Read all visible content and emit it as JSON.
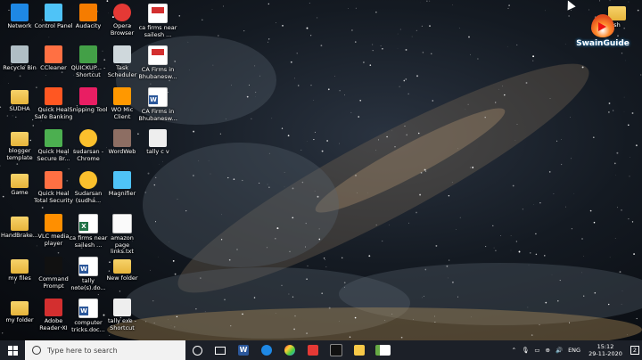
{
  "desktop": {
    "icons": [
      {
        "label": "Network",
        "type": "network",
        "col": 0,
        "row": 0
      },
      {
        "label": "Control Panel",
        "type": "control",
        "col": 1,
        "row": 0
      },
      {
        "label": "Audacity",
        "type": "audacity",
        "col": 2,
        "row": 0
      },
      {
        "label": "Opera Browser",
        "type": "opera",
        "col": 3,
        "row": 0
      },
      {
        "label": "ca firms near sailesh ...",
        "type": "pdf",
        "col": 4,
        "row": 0
      },
      {
        "label": "Recycle Bin",
        "type": "recycle",
        "col": 0,
        "row": 1
      },
      {
        "label": "CCleaner",
        "type": "ccleaner",
        "col": 1,
        "row": 1
      },
      {
        "label": "QUICKUP... - Shortcut",
        "type": "quickup",
        "col": 2,
        "row": 1
      },
      {
        "label": "Task Scheduler",
        "type": "task",
        "col": 3,
        "row": 1
      },
      {
        "label": "CA Firms in Bhubanesw...",
        "type": "pdf",
        "col": 4,
        "row": 1
      },
      {
        "label": "SUDHA",
        "type": "folder",
        "col": 0,
        "row": 2
      },
      {
        "label": "Quick Heal Safe Banking",
        "type": "qhbank",
        "col": 1,
        "row": 2
      },
      {
        "label": "Snipping Tool",
        "type": "snip",
        "col": 2,
        "row": 2
      },
      {
        "label": "WO Mic Client",
        "type": "womic",
        "col": 3,
        "row": 2
      },
      {
        "label": "CA Firms in Bhubanesw...",
        "type": "word",
        "col": 4,
        "row": 2
      },
      {
        "label": "blogger template",
        "type": "folder",
        "col": 0,
        "row": 3
      },
      {
        "label": "Quick Heal Secure Br...",
        "type": "qhsecure",
        "col": 1,
        "row": 3
      },
      {
        "label": "sudarsan - Chrome",
        "type": "chrome",
        "col": 2,
        "row": 3
      },
      {
        "label": "WordWeb",
        "type": "wordweb",
        "col": 3,
        "row": 3
      },
      {
        "label": "tally c v",
        "type": "tally",
        "col": 4,
        "row": 3
      },
      {
        "label": "Game",
        "type": "folder",
        "col": 0,
        "row": 4
      },
      {
        "label": "Quick Heal Total Security",
        "type": "qhtotal",
        "col": 1,
        "row": 4
      },
      {
        "label": "Sudarsan (sudha...",
        "type": "chrome",
        "col": 2,
        "row": 4
      },
      {
        "label": "Magnifier",
        "type": "magnifier",
        "col": 3,
        "row": 4
      },
      {
        "label": "HandBrake...",
        "type": "folder",
        "col": 0,
        "row": 5
      },
      {
        "label": "VLC media player",
        "type": "vlc",
        "col": 1,
        "row": 5
      },
      {
        "label": "ca firms near sailesh ...",
        "type": "excel",
        "col": 2,
        "row": 5
      },
      {
        "label": "amazon page links.txt",
        "type": "txt",
        "col": 3,
        "row": 5
      },
      {
        "label": "my files",
        "type": "folder",
        "col": 0,
        "row": 6
      },
      {
        "label": "Command Prompt",
        "type": "cmd",
        "col": 1,
        "row": 6
      },
      {
        "label": "tally note(s).do...",
        "type": "word",
        "col": 2,
        "row": 6
      },
      {
        "label": "New folder",
        "type": "folder",
        "col": 3,
        "row": 6
      },
      {
        "label": "my folder",
        "type": "folder",
        "col": 0,
        "row": 7
      },
      {
        "label": "Adobe Reader XI",
        "type": "adobe",
        "col": 1,
        "row": 7
      },
      {
        "label": "computer tricks.doc...",
        "type": "word",
        "col": 2,
        "row": 7
      },
      {
        "label": "tally exe - Shortcut",
        "type": "tally",
        "col": 3,
        "row": 7
      }
    ],
    "corner_icon": {
      "label": "sh",
      "type": "folder"
    },
    "logo_text": "SwainGuide"
  },
  "taskbar": {
    "search_placeholder": "Type here to search",
    "pinned": [
      "cortana-icon",
      "task-view-icon",
      "word-icon",
      "edge-icon",
      "paint-icon",
      "media-icon",
      "cmd-icon",
      "explorer-icon",
      "book-icon"
    ],
    "tray": {
      "language": "ENG",
      "time": "15:12",
      "date": "29-11-2020",
      "notification_count": "2"
    }
  },
  "colors": {
    "taskbar_bg": "#1c2028",
    "search_bg": "#f2f2f2",
    "windows_blue": "#0078d7"
  }
}
